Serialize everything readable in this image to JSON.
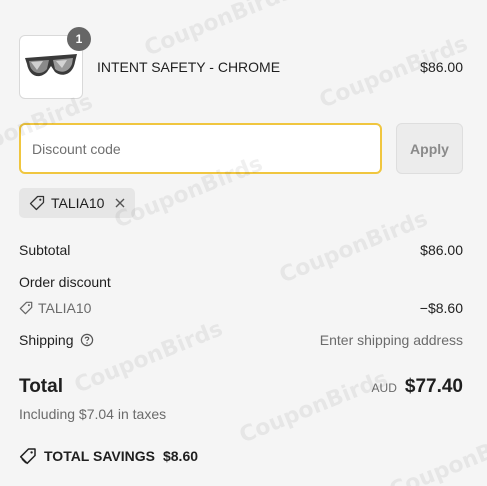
{
  "product": {
    "quantity": "1",
    "name": "INTENT SAFETY - CHROME",
    "price": "$86.00",
    "image_icon": "sunglasses-icon"
  },
  "discount": {
    "placeholder": "Discount code",
    "apply_label": "Apply",
    "applied_code": "TALIA10"
  },
  "summary": {
    "subtotal_label": "Subtotal",
    "subtotal_value": "$86.00",
    "order_discount_label": "Order discount",
    "discount_code": "TALIA10",
    "discount_value": "−$8.60",
    "shipping_label": "Shipping",
    "shipping_value": "Enter shipping address",
    "total_label": "Total",
    "currency": "AUD",
    "total_value": "$77.40",
    "taxes_note": "Including $7.04 in taxes",
    "savings_label": "TOTAL SAVINGS",
    "savings_value": "$8.60"
  },
  "colors": {
    "focus_border": "#f0c63f",
    "background": "#f5f5f5",
    "badge": "#666666"
  }
}
